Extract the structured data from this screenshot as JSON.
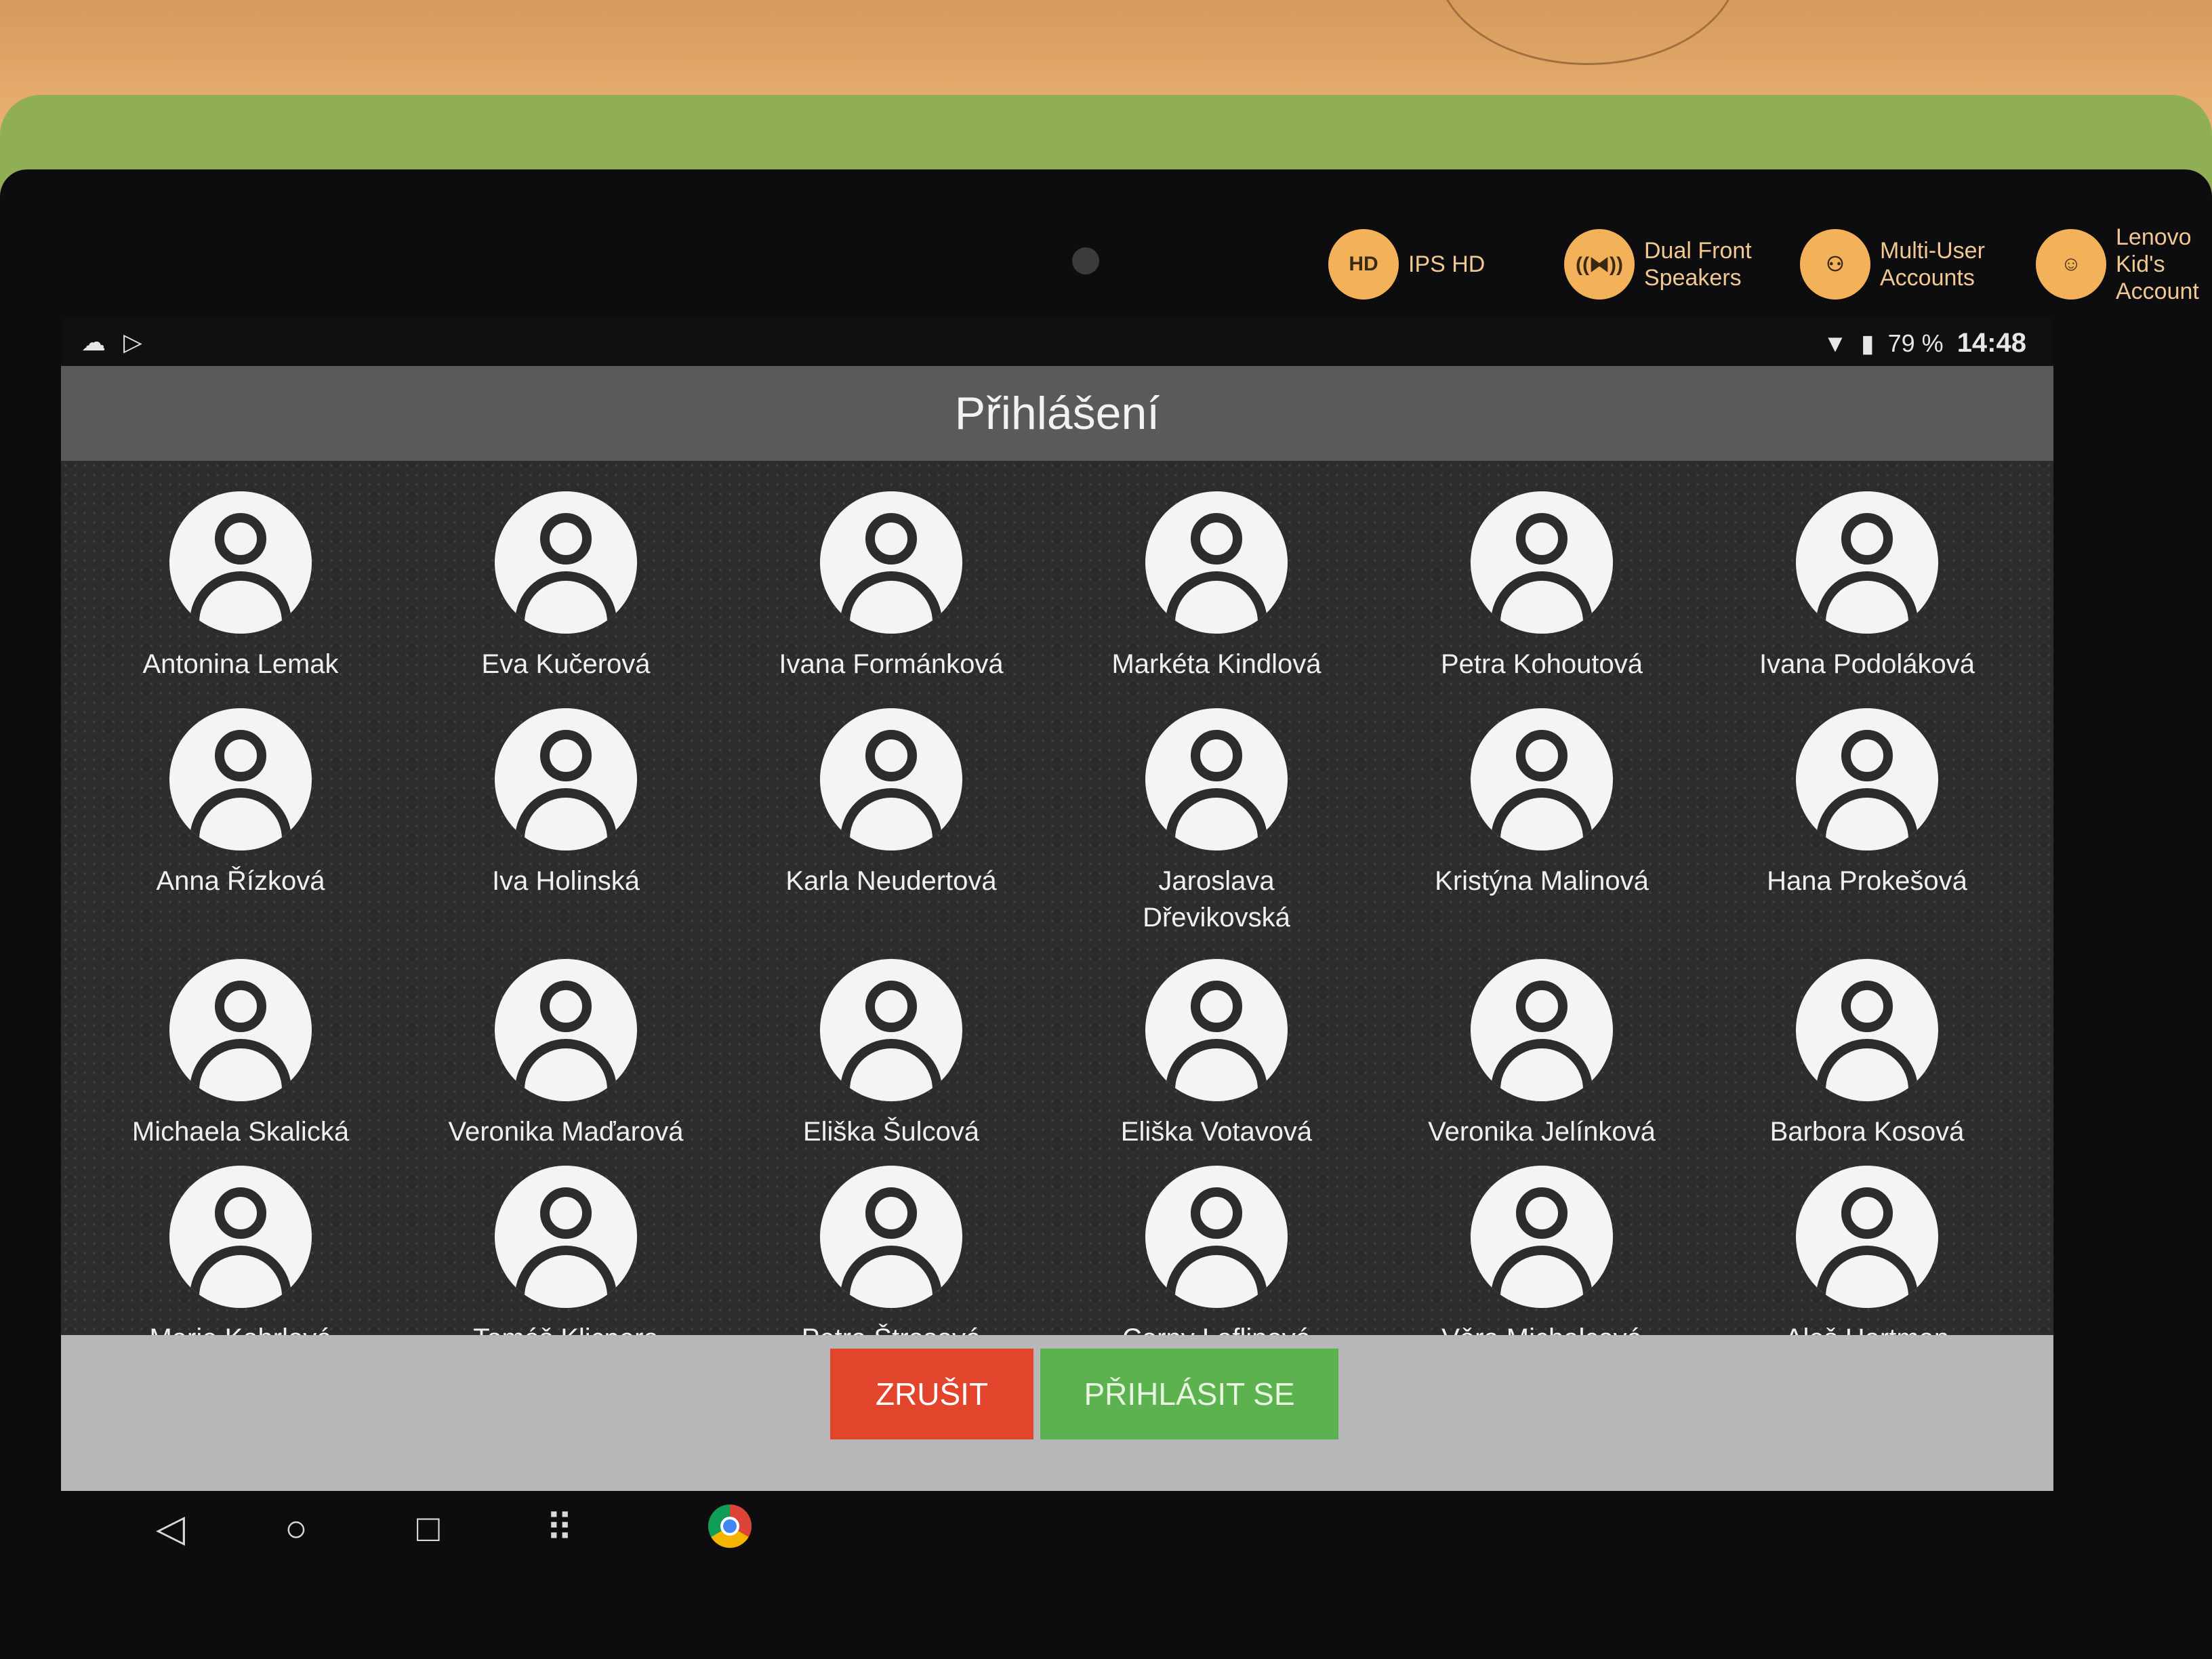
{
  "device": {
    "features": [
      {
        "icon": "hd-icon",
        "badge": "HD",
        "label": "IPS HD"
      },
      {
        "icon": "speakers-icon",
        "badge": "((⧓))",
        "label": "Dual Front\nSpeakers"
      },
      {
        "icon": "multi-user-icon",
        "badge": "⚇",
        "label": "Multi-User\nAccounts"
      },
      {
        "icon": "kids-account-icon",
        "badge": "☺",
        "label": "Lenovo\nKid's\nAccount"
      }
    ]
  },
  "status": {
    "left_icons": [
      "☁",
      "▷"
    ],
    "battery": "79 %",
    "time": "14:48"
  },
  "screen": {
    "title": "Přihlášení"
  },
  "users": [
    "Antonina Lemak",
    "Eva Kučerová",
    "Ivana Formánková",
    "Markéta Kindlová",
    "Petra Kohoutová",
    "Ivana Podoláková",
    "Anna Řízková",
    "Iva Holinská",
    "Karla Neudertová",
    "Jaroslava Dřevikovská",
    "Kristýna Malinová",
    "Hana Prokešová",
    "Michaela Skalická",
    "Veronika Maďarová",
    "Eliška Šulcová",
    "Eliška Votavová",
    "Veronika Jelínková",
    "Barbora Kosová",
    "Marie Kobrlová",
    "Tomáš Klicpera",
    "Petra Štrosová",
    "Corny Laflinová",
    "Věra Michalcová",
    "Aleš Hartman"
  ],
  "actions": {
    "cancel_label": "ZRUŠIT",
    "login_label": "PŘIHLÁSIT SE"
  },
  "nav": {
    "back": "◁",
    "home": "○",
    "recents": "□",
    "apps": "⠿"
  },
  "colors": {
    "cancel": "#e2452c",
    "login": "#5bb24f",
    "case": "#8fae55"
  }
}
